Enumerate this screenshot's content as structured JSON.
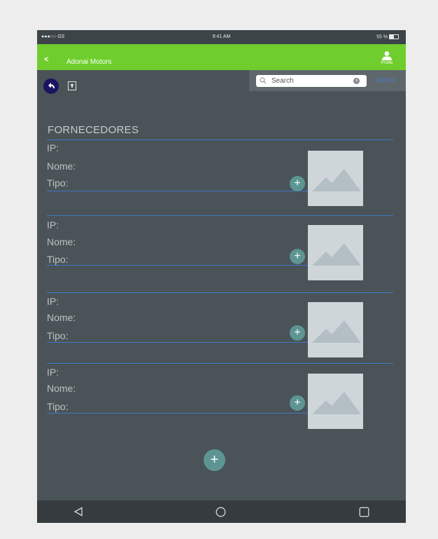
{
  "status": {
    "carrier": "●●●○○ GS",
    "time": "9:41 AM",
    "battery": "55 %"
  },
  "appbar": {
    "back_label": "<",
    "title": "Adonai Motors",
    "profile_label": "Profile"
  },
  "search": {
    "placeholder": "Search",
    "cancel_label": "Cancel"
  },
  "page": {
    "heading": "FORNECEDORES"
  },
  "fields": {
    "ip": "IP:",
    "nome": "Nome:",
    "tipo": "Tipo:"
  },
  "suppliers": [
    {
      "ip": "",
      "nome": "",
      "tipo": ""
    },
    {
      "ip": "",
      "nome": "",
      "tipo": ""
    },
    {
      "ip": "",
      "nome": "",
      "tipo": ""
    },
    {
      "ip": "",
      "nome": "",
      "tipo": ""
    }
  ],
  "actions": {
    "add_label": "+",
    "add_supplier_label": "+"
  },
  "icons": {
    "back": "back-icon",
    "profile": "person-icon",
    "search": "search-icon",
    "clear": "clear-icon",
    "nav_back": "nav-back-icon",
    "export": "export-icon",
    "image": "image-placeholder-icon",
    "android_back": "triangle-icon",
    "android_home": "circle-icon",
    "android_recents": "square-icon"
  },
  "colors": {
    "appbar": "#6fce2d",
    "background": "#4a5357",
    "divider": "#3f77c9",
    "fab": "#5d9593",
    "nav_button": "#1a1460"
  }
}
